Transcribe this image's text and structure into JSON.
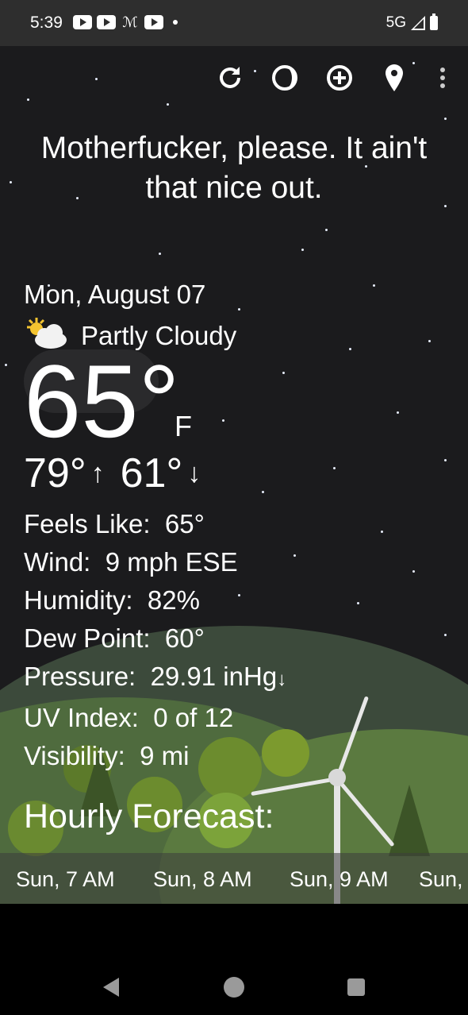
{
  "status": {
    "time": "5:39",
    "network": "5G",
    "notification_icons": [
      "youtube-icon",
      "youtube-icon",
      "gmail-icon",
      "youtube-icon",
      "dot-icon"
    ]
  },
  "toolbar": {
    "icons": [
      "refresh-icon",
      "theme-icon",
      "add-location-icon",
      "location-pin-icon",
      "more-vert-icon"
    ]
  },
  "quote": "Motherfucker, please. It ain't that nice out.",
  "current": {
    "date": "Mon, August 07",
    "condition": "Partly Cloudy",
    "temp": "65°",
    "unit": "F",
    "high": "79°",
    "low": "61°"
  },
  "details": {
    "feels_like_label": "Feels Like:",
    "feels_like": "65°",
    "wind_label": "Wind:",
    "wind": "9 mph ESE",
    "humidity_label": "Humidity:",
    "humidity": "82%",
    "dew_point_label": "Dew Point:",
    "dew_point": "60°",
    "pressure_label": "Pressure:",
    "pressure": "29.91 inHg",
    "uv_label": "UV Index:",
    "uv": "0 of 12",
    "visibility_label": "Visibility:",
    "visibility": "9 mi"
  },
  "hourly": {
    "title": "Hourly Forecast:",
    "hours": [
      "Sun, 7 AM",
      "Sun, 8 AM",
      "Sun, 9 AM",
      "Sun,"
    ]
  },
  "colors": {
    "sky": "#1b1b1d",
    "status_bar": "#2e2e2e",
    "grass": "#5b7a40"
  }
}
